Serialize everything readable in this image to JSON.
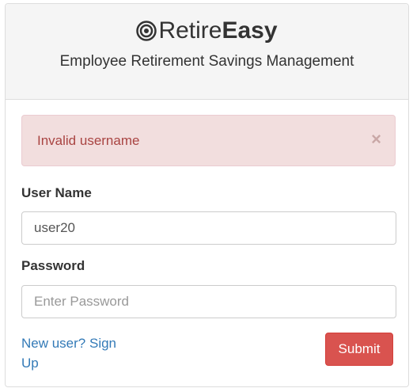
{
  "header": {
    "brand_prefix": "Retire",
    "brand_suffix": "Easy",
    "subtitle": "Employee Retirement Savings Management",
    "brand_icon": "bullseye-icon"
  },
  "alert": {
    "message": "Invalid username",
    "close_glyph": "×"
  },
  "form": {
    "username_label": "User Name",
    "username_value": "user20",
    "password_label": "Password",
    "password_placeholder": "Enter Password",
    "password_value": "",
    "signup_link": "New user? Sign Up",
    "submit_label": "Submit"
  },
  "colors": {
    "alert_bg": "#f2dede",
    "alert_text": "#a94442",
    "link": "#337ab7",
    "submit_bg": "#d9534f"
  }
}
